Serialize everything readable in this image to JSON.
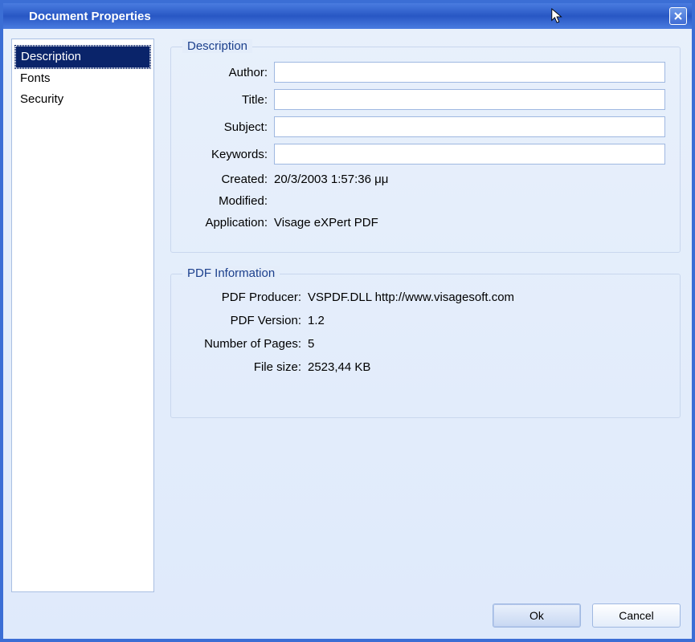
{
  "window": {
    "title": "Document Properties"
  },
  "sidebar": {
    "items": [
      {
        "label": "Description",
        "selected": true
      },
      {
        "label": "Fonts",
        "selected": false
      },
      {
        "label": "Security",
        "selected": false
      }
    ]
  },
  "description_group": {
    "legend": "Description",
    "fields": {
      "author": {
        "label": "Author:",
        "value": ""
      },
      "title": {
        "label": "Title:",
        "value": ""
      },
      "subject": {
        "label": "Subject:",
        "value": ""
      },
      "keywords": {
        "label": "Keywords:",
        "value": ""
      },
      "created": {
        "label": "Created:",
        "value": "20/3/2003 1:57:36 μμ"
      },
      "modified": {
        "label": "Modified:",
        "value": ""
      },
      "application": {
        "label": "Application:",
        "value": "Visage eXPert PDF"
      }
    }
  },
  "pdf_info_group": {
    "legend": "PDF Information",
    "fields": {
      "producer": {
        "label": "PDF Producer:",
        "value": "VSPDF.DLL http://www.visagesoft.com"
      },
      "version": {
        "label": "PDF Version:",
        "value": "1.2"
      },
      "pages": {
        "label": "Number of Pages:",
        "value": "5"
      },
      "filesize": {
        "label": "File size:",
        "value": "2523,44 KB"
      }
    }
  },
  "buttons": {
    "ok": "Ok",
    "cancel": "Cancel"
  }
}
